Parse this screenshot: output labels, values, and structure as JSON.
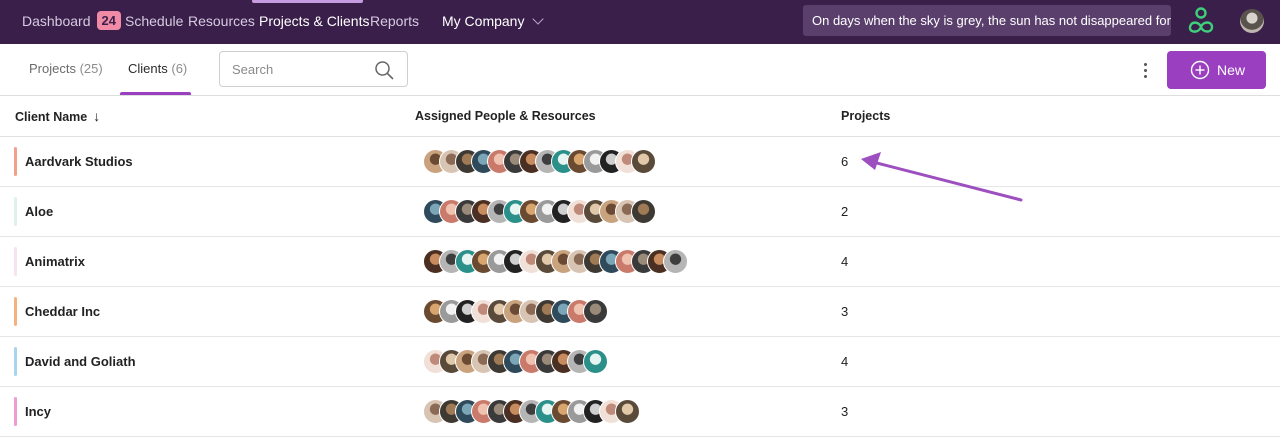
{
  "nav": {
    "dashboard": "Dashboard",
    "dashboard_badge": "24",
    "schedule": "Schedule",
    "resources": "Resources",
    "projects_clients": "Projects & Clients",
    "reports": "Reports",
    "company": "My Company",
    "quote": "On days when the sky is grey, the sun has not disappeared forever",
    "colors": {
      "bg": "#3a1f4a",
      "accent": "#9a3fc0",
      "logo": "#3fd07a"
    }
  },
  "tabs": [
    {
      "label": "Projects",
      "count": "(25)"
    },
    {
      "label": "Clients",
      "count": "(6)"
    }
  ],
  "search": {
    "placeholder": "Search"
  },
  "actions": {
    "new_label": "New"
  },
  "table": {
    "headers": {
      "client_name": "Client Name",
      "sort_indicator": "↓",
      "assigned": "Assigned People & Resources",
      "projects": "Projects"
    },
    "rows": [
      {
        "name": "Aardvark Studios",
        "color": "#f2a08e",
        "projects": "6",
        "avatar_count": 14
      },
      {
        "name": "Aloe",
        "color": "#dff2ea",
        "projects": "2",
        "avatar_count": 14
      },
      {
        "name": "Animatrix",
        "color": "#f6e2f0",
        "projects": "4",
        "avatar_count": 16
      },
      {
        "name": "Cheddar Inc",
        "color": "#f6b27e",
        "projects": "3",
        "avatar_count": 11
      },
      {
        "name": "David and Goliath",
        "color": "#a9d3ee",
        "projects": "4",
        "avatar_count": 11
      },
      {
        "name": "Incy",
        "color": "#f29ad3",
        "projects": "3",
        "avatar_count": 13
      }
    ]
  }
}
